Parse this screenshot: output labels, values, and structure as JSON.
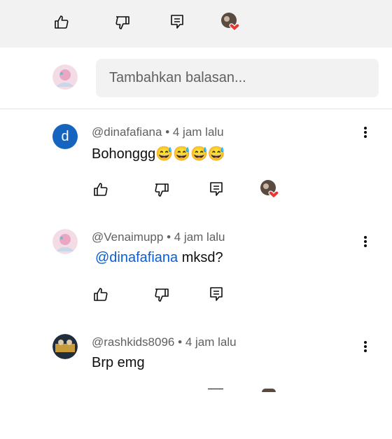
{
  "reply_box": {
    "placeholder": "Tambahkan balasan..."
  },
  "comments": [
    {
      "author": "@dinafafiana",
      "time": "4 jam lalu",
      "text": "Bohonggg😅😅😅😅",
      "avatar_letter": "d"
    },
    {
      "author": "@Venaimupp",
      "time": "4 jam lalu",
      "mention": "@dinafafiana",
      "text": " mksd?"
    },
    {
      "author": "@rashkids8096",
      "time": "4 jam lalu",
      "text": "Brp emg"
    }
  ],
  "separator": "•",
  "colors": {
    "link": "#065fd4",
    "heart": "#e53935",
    "avatar_blue": "#1565c0"
  }
}
